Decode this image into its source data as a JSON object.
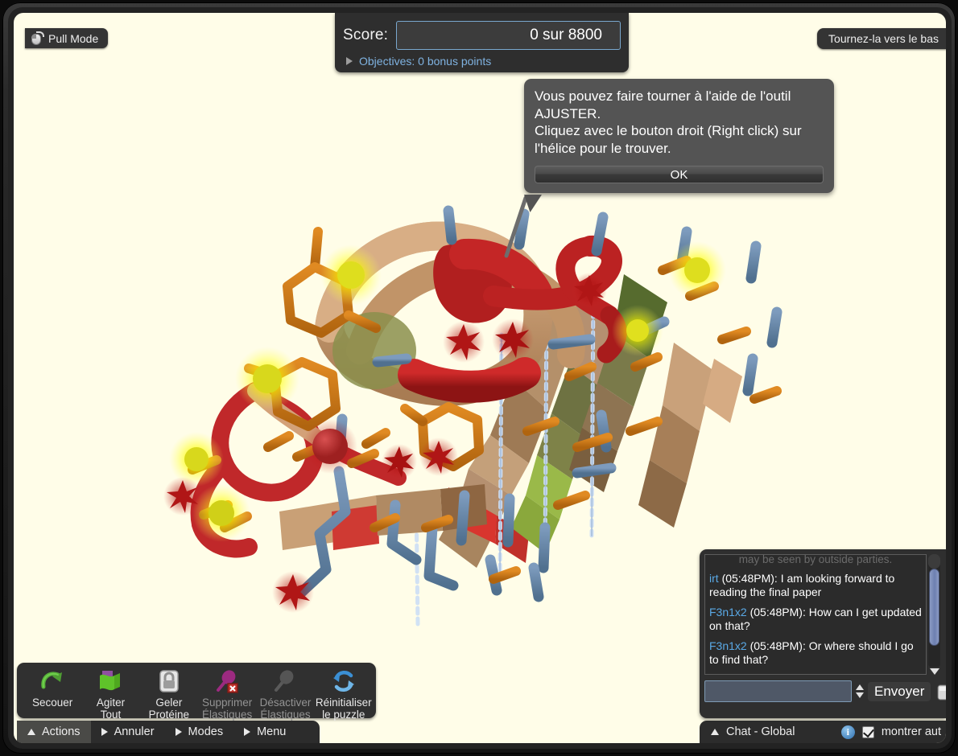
{
  "window": {
    "pull_mode_label": "Pull Mode",
    "pull_mode_icon": "mouse-icon",
    "hint_tab_label": "Tournez-la vers le bas"
  },
  "score_panel": {
    "label": "Score:",
    "value": "0 sur 8800",
    "objectives_text": "Objectives: 0 bonus points",
    "objectives_toggle_icon": "triangle-right-icon",
    "accent_border": "#7aa8cf",
    "objectives_color": "#7fb2e0"
  },
  "tooltip": {
    "line1": "Vous pouvez faire tourner à l'aide de l'outil AJUSTER.",
    "line2": "Cliquez avec le bouton droit (Right click) sur l'hélice pour le trouver.",
    "ok_label": "OK",
    "background": "#545454"
  },
  "actions_toolbar": {
    "items": [
      {
        "label_line1": "Secouer",
        "label_line2": "",
        "icon": "shake-arrow-icon",
        "enabled": true
      },
      {
        "label_line1": "Agiter",
        "label_line2": "Tout",
        "icon": "wiggle-all-icon",
        "enabled": true
      },
      {
        "label_line1": "Geler",
        "label_line2": "Protéine",
        "icon": "freeze-lock-icon",
        "enabled": true
      },
      {
        "label_line1": "Supprimer",
        "label_line2": "Élastiques",
        "icon": "remove-bands-icon",
        "enabled": false
      },
      {
        "label_line1": "Désactiver",
        "label_line2": "Élastiques",
        "icon": "disable-bands-icon",
        "enabled": false
      },
      {
        "label_line1": "Réinitialiser",
        "label_line2": "le puzzle",
        "icon": "reset-puzzle-icon",
        "enabled": true
      }
    ]
  },
  "menu_strip": {
    "items": [
      {
        "label": "Actions",
        "icon": "triangle-up-icon",
        "active": true
      },
      {
        "label": "Annuler",
        "icon": "triangle-right-icon",
        "active": false
      },
      {
        "label": "Modes",
        "icon": "triangle-right-icon",
        "active": false
      },
      {
        "label": "Menu",
        "icon": "triangle-right-icon",
        "active": false
      }
    ]
  },
  "chat": {
    "faded_top_message": "may be seen by outside parties.",
    "messages": [
      {
        "user": "irt",
        "time": "(05:48PM):",
        "text": "I am looking forward to reading the final paper"
      },
      {
        "user": "F3n1x2",
        "time": "(05:48PM):",
        "text": "How can I get updated on that?"
      },
      {
        "user": "F3n1x2",
        "time": "(05:48PM):",
        "text": "Or where should I go to find that?"
      }
    ],
    "input_value": "",
    "input_placeholder": "",
    "send_label": "Envoyer",
    "camera_icon": "camera-icon",
    "scroll_up_icon": "triangle-up-icon",
    "scroll_down_icon": "triangle-down-icon",
    "status_label": "Chat - Global",
    "status_toggle_icon": "triangle-up-icon",
    "info_icon": "info-icon",
    "checkbox_checked": true,
    "checkbox_label": "montrer aut",
    "username_color": "#5aa9e6"
  },
  "viewport": {
    "background": "#fffde8",
    "content": "protein-3d-model"
  }
}
